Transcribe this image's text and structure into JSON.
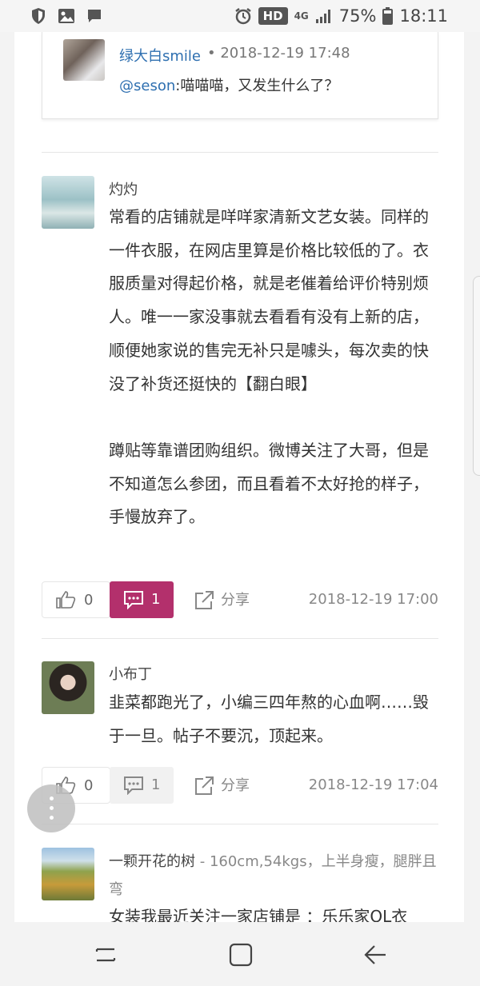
{
  "status_bar": {
    "battery": "75%",
    "time": "18:11",
    "hd_badge": "HD",
    "network": "4G",
    "icons": [
      "shield-icon",
      "image-icon",
      "message-icon",
      "alarm-icon",
      "signal-icon",
      "battery-icon"
    ]
  },
  "reply": {
    "username": "绿大白smile",
    "date": "• 2018-12-19 17:48",
    "mention": "@seson",
    "text": ":喵喵喵，又发生什么了？"
  },
  "posts": [
    {
      "username": "灼灼",
      "signature": "",
      "paragraphs": [
        "常看的店铺就是咩咩家清新文艺女装。同样的一件衣服，在网店里算是价格比较低的了。衣服质量对得起价格，就是老催着给评价特别烦人。唯一一家没事就去看看有没有上新的店，顺便她家说的售完无补只是噱头，每次卖的快没了补货还挺快的【翻白眼】",
        "蹲贴等靠谱团购组织。微博关注了大哥，但是不知道怎么参团，而且看着不太好抢的样子，手慢放弃了。"
      ],
      "likes": "0",
      "comments": "1",
      "share_label": "分享",
      "time": "2018-12-19 17:00",
      "comment_active": true
    },
    {
      "username": "小布丁",
      "signature": "",
      "paragraphs": [
        "韭菜都跑光了，小编三四年熬的心血啊……毁于一旦。帖子不要沉，顶起来。"
      ],
      "likes": "0",
      "comments": "1",
      "share_label": "分享",
      "time": "2018-12-19 17:04",
      "comment_active": false
    },
    {
      "username": "一颗开花的树",
      "signature": " - 160cm,54kgs，上半身瘦，腿胖且弯",
      "paragraphs": [
        "女装我最近关注一家店铺是 ：乐乐家OL衣"
      ]
    }
  ],
  "colors": {
    "accent": "#b3306c",
    "link": "#2e6fb0"
  },
  "nav": {
    "icons": [
      "recent-apps-icon",
      "home-icon",
      "back-icon"
    ]
  }
}
